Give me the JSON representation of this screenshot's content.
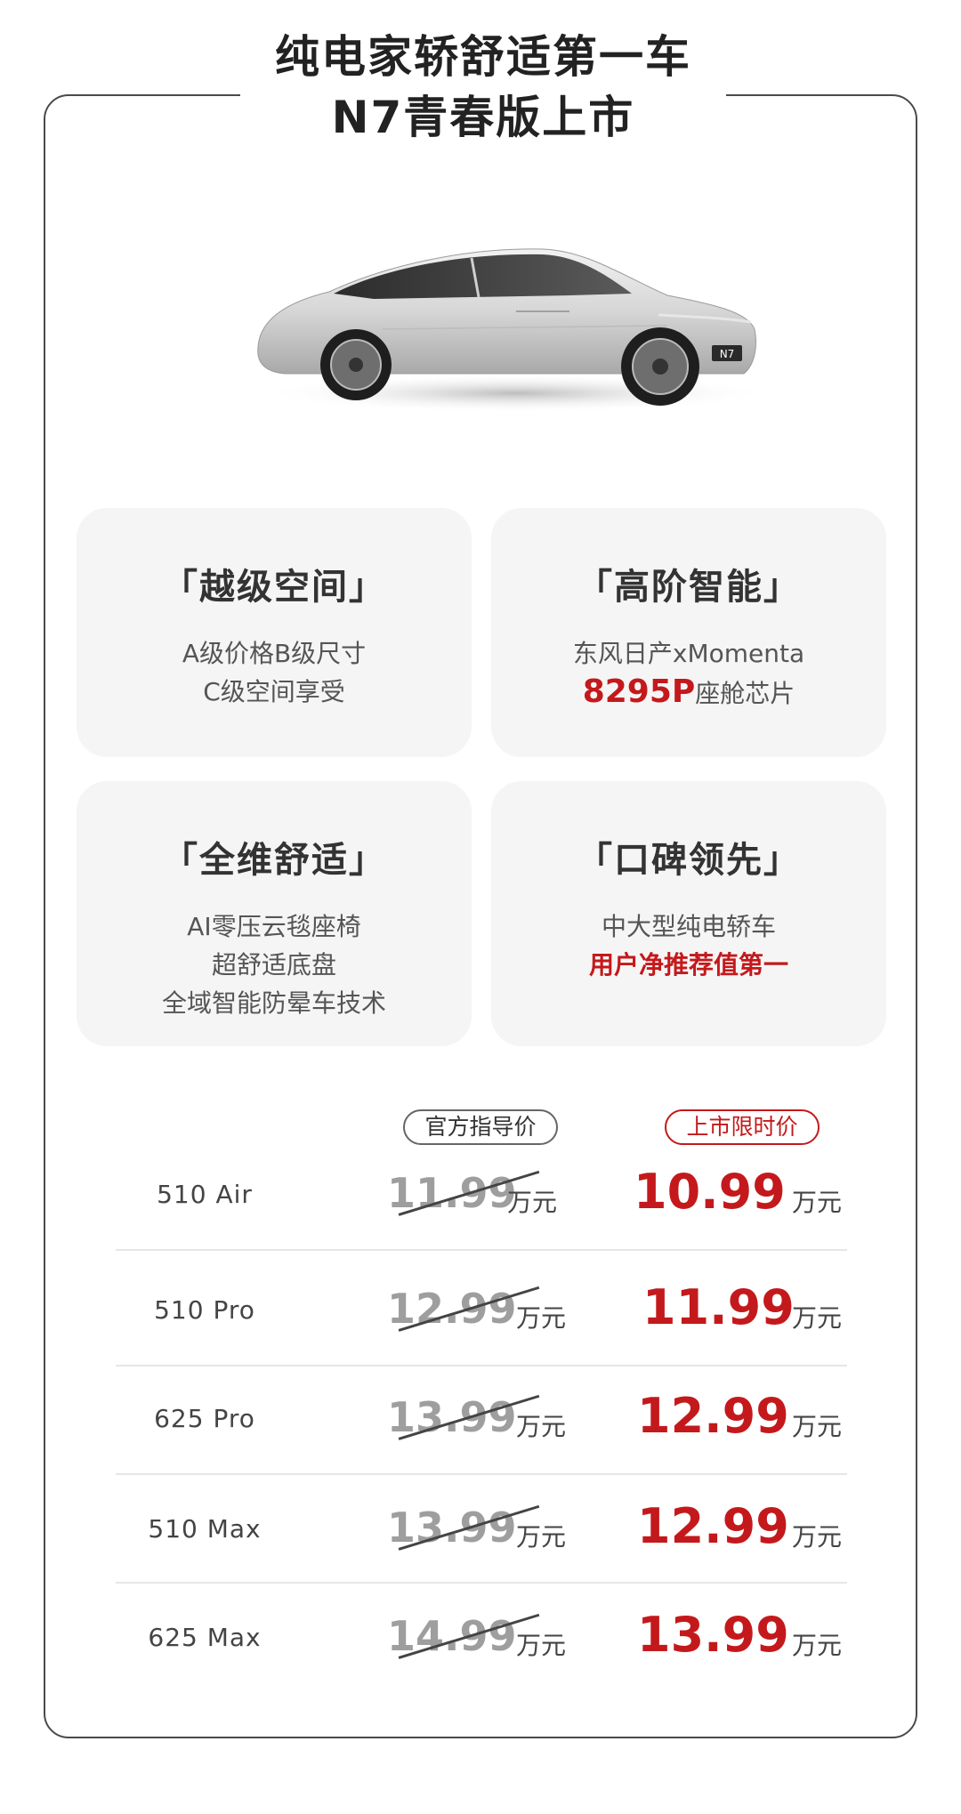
{
  "header": {
    "title_line1": "纯电家轿舒适第一车",
    "title_line2": "N7青春版上市"
  },
  "car": {
    "badge": "N7"
  },
  "features": [
    {
      "title": "「越级空间」",
      "lines": [
        "A级价格B级尺寸",
        "C级空间享受"
      ]
    },
    {
      "title": "「高阶智能」",
      "line1": "东风日产xMomenta",
      "highlight": "8295P",
      "line2_rest": "座舱芯片"
    },
    {
      "title": "「全维舒适」",
      "lines": [
        "AI零压云毯座椅",
        "超舒适底盘",
        "全域智能防晕车技术"
      ]
    },
    {
      "title": "「口碑领先」",
      "line1": "中大型纯电轿车",
      "highlight_line": "用户净推荐值第一"
    }
  ],
  "price_table": {
    "header_official": "官方指导价",
    "header_launch": "上市限时价",
    "unit": "万元",
    "rows": [
      {
        "model": "510 Air",
        "official": "11.99",
        "launch": "10.99"
      },
      {
        "model": "510 Pro",
        "official": "12.99",
        "launch": "11.99"
      },
      {
        "model": "625 Pro",
        "official": "13.99",
        "launch": "12.99"
      },
      {
        "model": "510 Max",
        "official": "13.99",
        "launch": "12.99"
      },
      {
        "model": "625 Max",
        "official": "14.99",
        "launch": "13.99"
      }
    ]
  },
  "colors": {
    "accent": "#c4191c",
    "card_bg": "#f6f5f5",
    "frame": "#4a4a4a"
  }
}
